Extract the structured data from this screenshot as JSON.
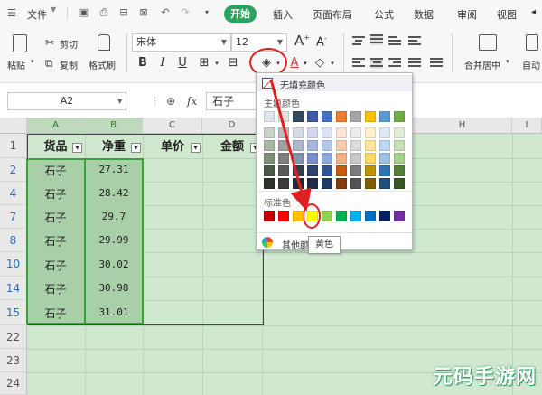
{
  "menu": {
    "file_label": "文件",
    "tabs": [
      {
        "label": "开始",
        "active": true
      },
      {
        "label": "插入"
      },
      {
        "label": "页面布局"
      },
      {
        "label": "公式"
      },
      {
        "label": "数据"
      },
      {
        "label": "审阅"
      },
      {
        "label": "视图"
      }
    ]
  },
  "toolbar": {
    "paste_label": "粘贴",
    "cut_label": "剪切",
    "copy_label": "复制",
    "format_painter_label": "格式刷",
    "font_name": "宋体",
    "font_size": "12",
    "merge_label": "合并居中",
    "autowrap_label": "自动"
  },
  "formula_bar": {
    "cell_ref": "A2",
    "fx": "fx",
    "content": "石子"
  },
  "columns": [
    "A",
    "B",
    "C",
    "D",
    "E",
    "H",
    "I"
  ],
  "rows": [
    "1",
    "2",
    "4",
    "7",
    "8",
    "10",
    "14",
    "15",
    "22",
    "23",
    "24"
  ],
  "table": {
    "headers": [
      "货品",
      "净重",
      "单价",
      "金额"
    ],
    "items": [
      {
        "name": "石子",
        "weight": "27.31"
      },
      {
        "name": "石子",
        "weight": "28.42"
      },
      {
        "name": "石子",
        "weight": "29.7"
      },
      {
        "name": "石子",
        "weight": "29.99"
      },
      {
        "name": "石子",
        "weight": "30.02"
      },
      {
        "name": "石子",
        "weight": "30.98"
      },
      {
        "name": "石子",
        "weight": "31.01"
      }
    ]
  },
  "color_popup": {
    "no_fill_label": "无填充颜色",
    "theme_title": "主题颜色",
    "standard_title": "标准色",
    "more_label": "其他颜色",
    "tooltip": "黄色",
    "theme_colors": [
      "#dfe6ee",
      "#e1e1e1",
      "#354a5f",
      "#3f5aa6",
      "#4472c4",
      "#ed7d31",
      "#a5a5a5",
      "#ffc000",
      "#5b9bd5",
      "#70ad47"
    ],
    "theme_shades": [
      [
        "#c9d5c4",
        "#bdbdbd",
        "#d6dce5",
        "#d2d9ee",
        "#dae3f3",
        "#fbe5d6",
        "#ededed",
        "#fff2cc",
        "#deebf7",
        "#e2f0d9"
      ],
      [
        "#a9b8a4",
        "#a0a0a0",
        "#adb9ca",
        "#a7b5de",
        "#b4c7e7",
        "#f8cbad",
        "#dbdbdb",
        "#ffe699",
        "#bdd7ee",
        "#c5e0b4"
      ],
      [
        "#7f8f7a",
        "#7f7f7f",
        "#8497b0",
        "#7b8fcf",
        "#8faadc",
        "#f4b183",
        "#c9c9c9",
        "#ffd966",
        "#9dc3e6",
        "#a9d18e"
      ],
      [
        "#4b5a47",
        "#595959",
        "#333f50",
        "#2e4070",
        "#2f5597",
        "#c55a11",
        "#7b7b7b",
        "#bf9000",
        "#2e75b6",
        "#548235"
      ],
      [
        "#2b3428",
        "#3a3a3a",
        "#222a35",
        "#1f2a4b",
        "#203864",
        "#843c0c",
        "#525252",
        "#7f6000",
        "#1f4e79",
        "#385723"
      ]
    ],
    "standard_colors": [
      "#c00000",
      "#ff0000",
      "#ffc000",
      "#ffff00",
      "#92d050",
      "#00b050",
      "#00b0f0",
      "#0070c0",
      "#002060",
      "#7030a0"
    ]
  },
  "watermark": "元码手游网"
}
